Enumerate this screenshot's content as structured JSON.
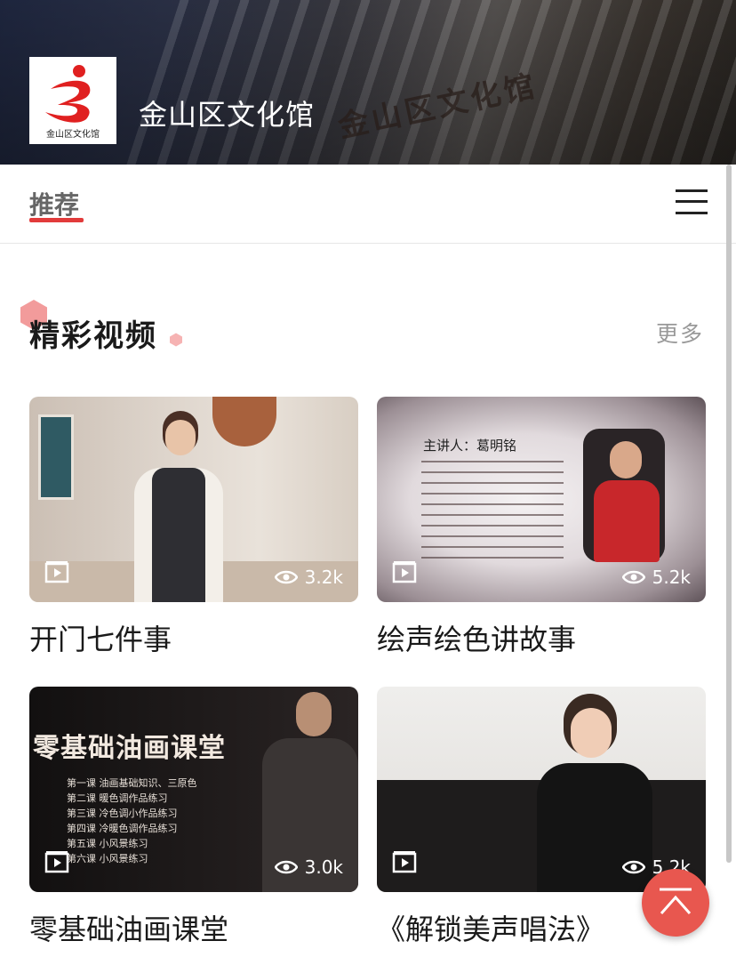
{
  "header": {
    "logo_text": "金山区文化馆",
    "site_name": "金山区文化馆",
    "building_sign": "金山区文化馆"
  },
  "nav": {
    "active_tab": "推荐",
    "menu_icon": "hamburger-icon"
  },
  "section": {
    "title": "精彩视频",
    "more_label": "更多"
  },
  "videos": [
    {
      "title": "开门七件事",
      "views": "3.2k"
    },
    {
      "title": "绘声绘色讲故事",
      "views": "5.2k",
      "thumb_text": "主讲人：葛明铭"
    },
    {
      "title": "零基础油画课堂",
      "views": "3.0k",
      "thumb_text": "零基础油画课堂",
      "lessons": [
        "第一课  油画基础知识、三原色",
        "第二课  暖色调作品练习",
        "第三课  冷色调小作品练习",
        "第四课  冷暖色调作品练习",
        "第五课  小风景练习",
        "第六课  小风景练习"
      ]
    },
    {
      "title": "《解锁美声唱法》",
      "views": "5.2k"
    }
  ],
  "colors": {
    "accent": "#e23b3b",
    "fab": "#e8574f"
  },
  "fab_icon": "back-to-top-icon"
}
